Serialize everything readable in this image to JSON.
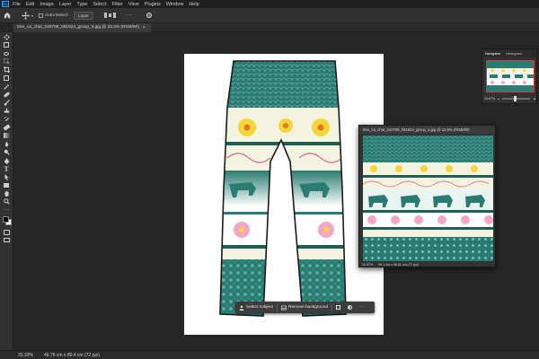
{
  "app": {
    "logo": "Ps"
  },
  "menubar": {
    "items": [
      "File",
      "Edit",
      "Image",
      "Layer",
      "Type",
      "Select",
      "Filter",
      "View",
      "Plugins",
      "Window",
      "Help"
    ]
  },
  "options": {
    "auto_select_label": "Auto-Select:",
    "layer_value": "Layer"
  },
  "tabs": [
    {
      "label": "tree_ca_chut_240709_091624_group_6.jpg @ 33.3% (RGB/8#)",
      "close": "×"
    }
  ],
  "float_window": {
    "title": "tree_ca_chut_240709_091624_group_5.jpg @ 12.5% (RGB/8#)",
    "zoom": "16.67%",
    "status": "96.1 cm x 46.81 cm (72 ppi)"
  },
  "navigator": {
    "tabs": [
      "Navigator",
      "Histogram"
    ],
    "zoom": "16.67%"
  },
  "taskbar": {
    "select_subject": "Select subject",
    "remove_background": "Remove background",
    "more": "···"
  },
  "status": {
    "zoom": "33.33%",
    "doc_size": "46.76 cm x 80.4 cm (72 ppi)"
  },
  "colors": {
    "teal": "#2d7a72",
    "dark_teal": "#1f5e57",
    "cream": "#f4f3df",
    "yellow": "#f5d53a",
    "pink": "#f2a7c6"
  }
}
